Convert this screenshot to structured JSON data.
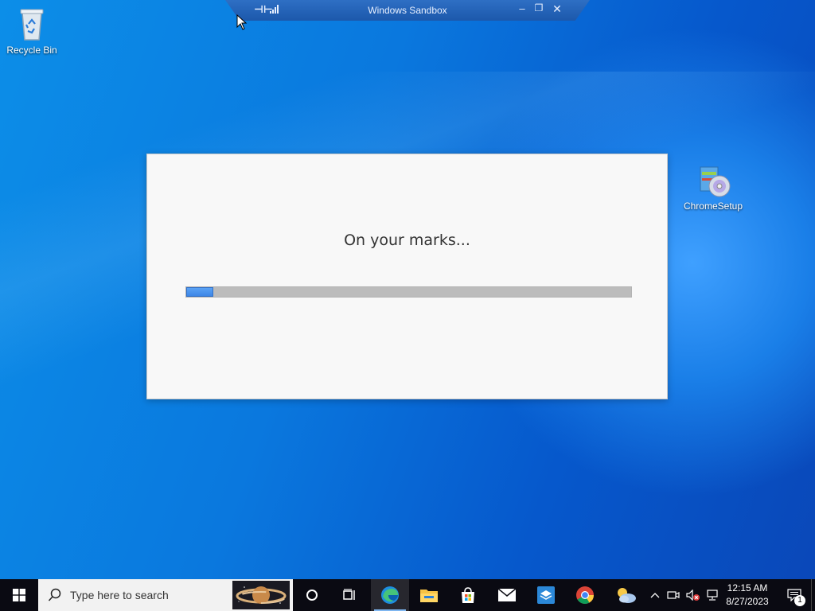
{
  "desktop": {
    "icons": [
      {
        "label": "Recycle Bin",
        "icon": "recycle-bin-icon"
      },
      {
        "label": "ChromeSetup",
        "icon": "installer-icon"
      }
    ]
  },
  "sandbox_bar": {
    "title": "Windows Sandbox",
    "pin_glyph": "⊣⊢",
    "minimize_glyph": "–",
    "restore_glyph": "❐",
    "close_glyph": "✕"
  },
  "installer": {
    "heading": "On your marks...",
    "progress_fraction": 0.06
  },
  "taskbar": {
    "search_placeholder": "Type here to search",
    "apps": [
      "cortana-icon",
      "task-view-icon",
      "edge-icon",
      "file-explorer-icon",
      "store-icon",
      "mail-icon",
      "sandbox-icon",
      "chrome-icon",
      "weather-icon"
    ],
    "clock_time": "12:15 AM",
    "clock_date": "8/27/2023",
    "notification_count": "1"
  },
  "colors": {
    "accent": "#3d86e6",
    "taskbar": "#0a0a12",
    "desktop": "#0a78de"
  }
}
